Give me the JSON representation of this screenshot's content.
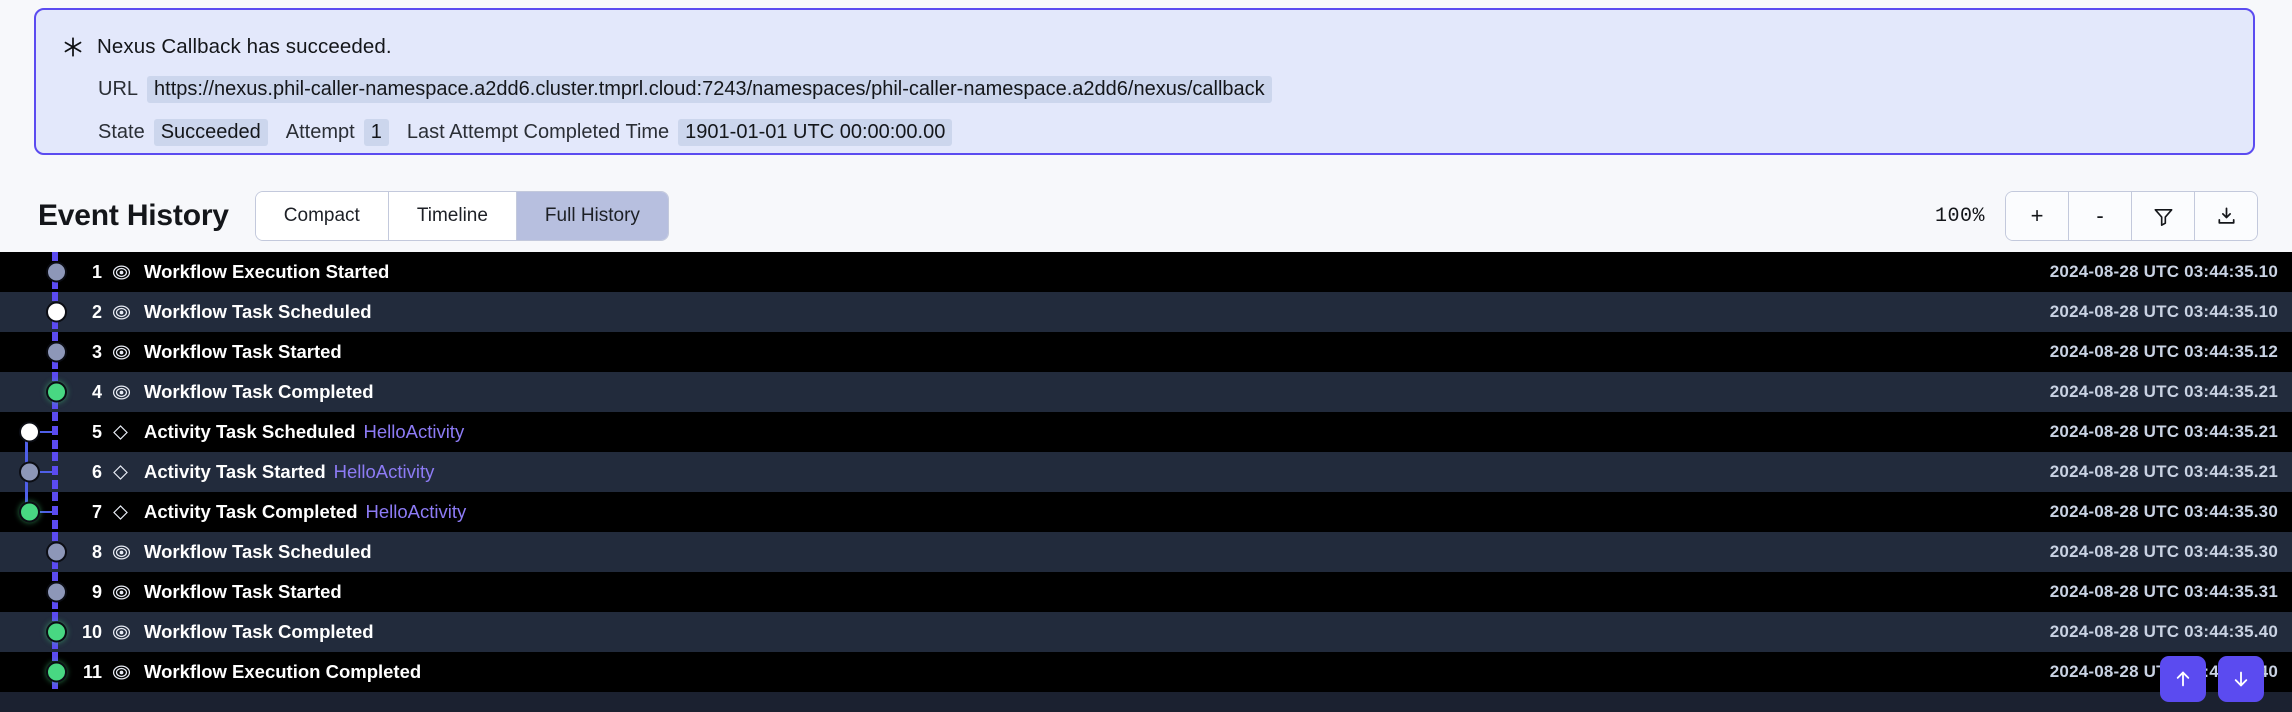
{
  "banner": {
    "icon": "asterisk-icon",
    "title": "Nexus Callback has succeeded.",
    "url_label": "URL",
    "url_value": "https://nexus.phil-caller-namespace.a2dd6.cluster.tmprl.cloud:7243/namespaces/phil-caller-namespace.a2dd6/nexus/callback",
    "state_label": "State",
    "state_value": "Succeeded",
    "attempt_label": "Attempt",
    "attempt_value": "1",
    "last_attempt_label": "Last Attempt Completed Time",
    "last_attempt_value": "1901-01-01 UTC 00:00:00.00",
    "border_color": "#5b4bf0",
    "background_color": "#e3e8fb"
  },
  "toolbar": {
    "title": "Event History",
    "views": [
      {
        "label": "Compact",
        "active": false
      },
      {
        "label": "Timeline",
        "active": false
      },
      {
        "label": "Full History",
        "active": true
      }
    ],
    "zoom_level": "100%",
    "zoom_in_label": "+",
    "zoom_out_label": "-",
    "filter_icon": "funnel-icon",
    "download_icon": "download-icon"
  },
  "events": [
    {
      "id": "1",
      "glyph": "workflow",
      "label": "Workflow Execution Started",
      "detail": "",
      "time": "2024-08-28 UTC 03:44:35.10",
      "marker": "pending",
      "track": "workflow"
    },
    {
      "id": "2",
      "glyph": "workflow",
      "label": "Workflow Task Scheduled",
      "detail": "",
      "time": "2024-08-28 UTC 03:44:35.10",
      "marker": "active",
      "track": "workflow"
    },
    {
      "id": "3",
      "glyph": "workflow",
      "label": "Workflow Task Started",
      "detail": "",
      "time": "2024-08-28 UTC 03:44:35.12",
      "marker": "pending",
      "track": "workflow"
    },
    {
      "id": "4",
      "glyph": "workflow",
      "label": "Workflow Task Completed",
      "detail": "",
      "time": "2024-08-28 UTC 03:44:35.21",
      "marker": "success",
      "track": "workflow"
    },
    {
      "id": "5",
      "glyph": "activity",
      "label": "Activity Task Scheduled",
      "detail": "HelloActivity",
      "time": "2024-08-28 UTC 03:44:35.21",
      "marker": "active",
      "track": "activity-start"
    },
    {
      "id": "6",
      "glyph": "activity",
      "label": "Activity Task Started",
      "detail": "HelloActivity",
      "time": "2024-08-28 UTC 03:44:35.21",
      "marker": "pending",
      "track": "activity-mid"
    },
    {
      "id": "7",
      "glyph": "activity",
      "label": "Activity Task Completed",
      "detail": "HelloActivity",
      "time": "2024-08-28 UTC 03:44:35.30",
      "marker": "success",
      "track": "activity-end"
    },
    {
      "id": "8",
      "glyph": "workflow",
      "label": "Workflow Task Scheduled",
      "detail": "",
      "time": "2024-08-28 UTC 03:44:35.30",
      "marker": "pending",
      "track": "workflow"
    },
    {
      "id": "9",
      "glyph": "workflow",
      "label": "Workflow Task Started",
      "detail": "",
      "time": "2024-08-28 UTC 03:44:35.31",
      "marker": "pending",
      "track": "workflow"
    },
    {
      "id": "10",
      "glyph": "workflow",
      "label": "Workflow Task Completed",
      "detail": "",
      "time": "2024-08-28 UTC 03:44:35.40",
      "marker": "success",
      "track": "workflow"
    },
    {
      "id": "11",
      "glyph": "workflow",
      "label": "Workflow Execution Completed",
      "detail": "",
      "time": "2024-08-28 UTC 03:44:35.40",
      "marker": "success",
      "track": "workflow"
    }
  ],
  "nav": {
    "scroll_up_icon": "arrow-up-icon",
    "scroll_down_icon": "arrow-down-icon"
  },
  "colors": {
    "accent": "#5b4bf0",
    "success": "#48d882",
    "link": "#8d7bf5"
  }
}
